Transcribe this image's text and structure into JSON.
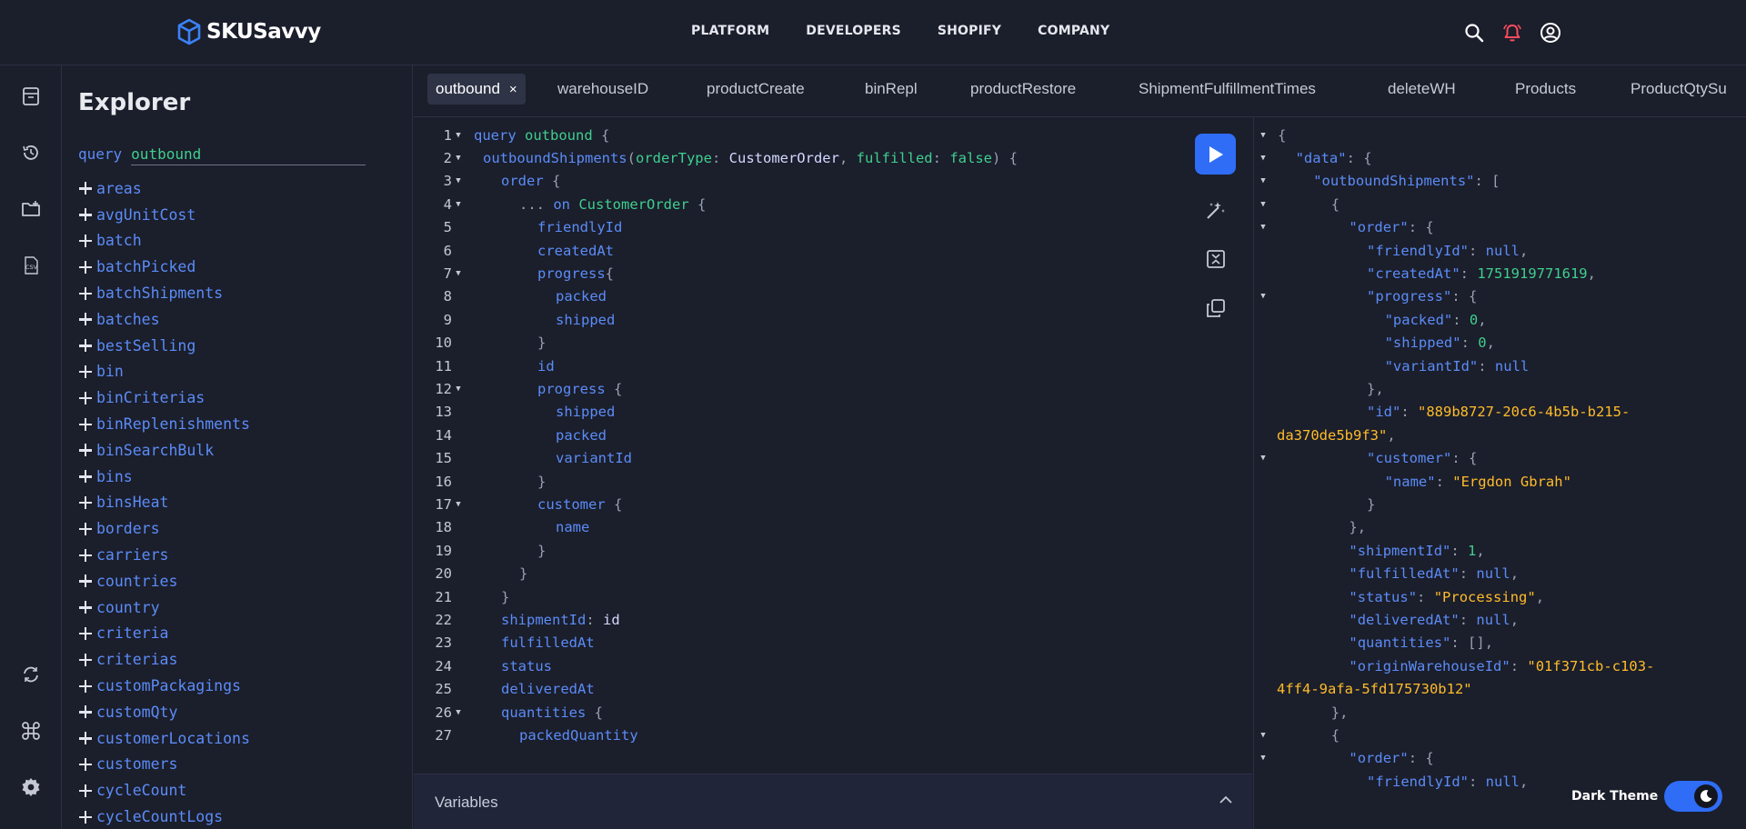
{
  "brand": {
    "name": "SKUSavvy"
  },
  "nav": {
    "links": [
      "PLATFORM",
      "DEVELOPERS",
      "SHOPIFY",
      "COMPANY"
    ]
  },
  "explorer": {
    "title": "Explorer",
    "query_keyword": "query",
    "query_name": "outbound",
    "fields": [
      "areas",
      "avgUnitCost",
      "batch",
      "batchPicked",
      "batchShipments",
      "batches",
      "bestSelling",
      "bin",
      "binCriterias",
      "binReplenishments",
      "binSearchBulk",
      "bins",
      "binsHeat",
      "borders",
      "carriers",
      "countries",
      "country",
      "criteria",
      "criterias",
      "customPackagings",
      "customQty",
      "customerLocations",
      "customers",
      "cycleCount",
      "cycleCountLogs"
    ]
  },
  "tabs": [
    {
      "label": "outbound",
      "active": true
    },
    {
      "label": "warehouseID"
    },
    {
      "label": "productCreate"
    },
    {
      "label": "binRepl"
    },
    {
      "label": "productRestore"
    },
    {
      "label": "ShipmentFulfillmentTimes"
    },
    {
      "label": "deleteWH"
    },
    {
      "label": "Products"
    },
    {
      "label": "ProductQtySu"
    }
  ],
  "tab_close": "×",
  "editor": {
    "lines": [
      {
        "n": "1",
        "fold": true,
        "indent": 0,
        "tokens": [
          [
            "k",
            "query"
          ],
          [
            "w",
            " "
          ],
          [
            "n",
            "outbound"
          ],
          [
            "p",
            " {"
          ]
        ]
      },
      {
        "n": "2",
        "fold": true,
        "indent": 1,
        "tokens": [
          [
            "f",
            "outboundShipments"
          ],
          [
            "p",
            "("
          ],
          [
            "a",
            "orderType"
          ],
          [
            "p",
            ": "
          ],
          [
            "ty",
            "CustomerOrder"
          ],
          [
            "p",
            ", "
          ],
          [
            "a",
            "fulfilled"
          ],
          [
            "p",
            ": "
          ],
          [
            "a",
            "false"
          ],
          [
            "p",
            ") {"
          ]
        ]
      },
      {
        "n": "3",
        "fold": true,
        "indent": 3,
        "tokens": [
          [
            "f",
            "order"
          ],
          [
            "p",
            " {"
          ]
        ]
      },
      {
        "n": "4",
        "fold": true,
        "indent": 5,
        "tokens": [
          [
            "p",
            "... "
          ],
          [
            "k",
            "on"
          ],
          [
            "w",
            " "
          ],
          [
            "n",
            "CustomerOrder"
          ],
          [
            "p",
            " {"
          ]
        ]
      },
      {
        "n": "5",
        "fold": false,
        "indent": 7,
        "tokens": [
          [
            "f",
            "friendlyId"
          ]
        ]
      },
      {
        "n": "6",
        "fold": false,
        "indent": 7,
        "tokens": [
          [
            "f",
            "createdAt"
          ]
        ]
      },
      {
        "n": "7",
        "fold": true,
        "indent": 7,
        "tokens": [
          [
            "f",
            "progress"
          ],
          [
            "p",
            "{"
          ]
        ]
      },
      {
        "n": "8",
        "fold": false,
        "indent": 9,
        "tokens": [
          [
            "f",
            "packed"
          ]
        ]
      },
      {
        "n": "9",
        "fold": false,
        "indent": 9,
        "tokens": [
          [
            "f",
            "shipped"
          ]
        ]
      },
      {
        "n": "10",
        "fold": false,
        "indent": 7,
        "tokens": [
          [
            "p",
            "}"
          ]
        ]
      },
      {
        "n": "11",
        "fold": false,
        "indent": 7,
        "tokens": [
          [
            "f",
            "id"
          ]
        ]
      },
      {
        "n": "12",
        "fold": true,
        "indent": 7,
        "tokens": [
          [
            "f",
            "progress"
          ],
          [
            "p",
            " {"
          ]
        ]
      },
      {
        "n": "13",
        "fold": false,
        "indent": 9,
        "tokens": [
          [
            "f",
            "shipped"
          ]
        ]
      },
      {
        "n": "14",
        "fold": false,
        "indent": 9,
        "tokens": [
          [
            "f",
            "packed"
          ]
        ]
      },
      {
        "n": "15",
        "fold": false,
        "indent": 9,
        "tokens": [
          [
            "f",
            "variantId"
          ]
        ]
      },
      {
        "n": "16",
        "fold": false,
        "indent": 7,
        "tokens": [
          [
            "p",
            "}"
          ]
        ]
      },
      {
        "n": "17",
        "fold": true,
        "indent": 7,
        "tokens": [
          [
            "f",
            "customer"
          ],
          [
            "p",
            " {"
          ]
        ]
      },
      {
        "n": "18",
        "fold": false,
        "indent": 9,
        "tokens": [
          [
            "f",
            "name"
          ]
        ]
      },
      {
        "n": "19",
        "fold": false,
        "indent": 7,
        "tokens": [
          [
            "p",
            "}"
          ]
        ]
      },
      {
        "n": "20",
        "fold": false,
        "indent": 5,
        "tokens": [
          [
            "p",
            "}"
          ]
        ]
      },
      {
        "n": "21",
        "fold": false,
        "indent": 3,
        "tokens": [
          [
            "p",
            "}"
          ]
        ]
      },
      {
        "n": "22",
        "fold": false,
        "indent": 3,
        "tokens": [
          [
            "f",
            "shipmentId"
          ],
          [
            "p",
            ": "
          ],
          [
            "ty",
            "id"
          ]
        ]
      },
      {
        "n": "23",
        "fold": false,
        "indent": 3,
        "tokens": [
          [
            "f",
            "fulfilledAt"
          ]
        ]
      },
      {
        "n": "24",
        "fold": false,
        "indent": 3,
        "tokens": [
          [
            "f",
            "status"
          ]
        ]
      },
      {
        "n": "25",
        "fold": false,
        "indent": 3,
        "tokens": [
          [
            "f",
            "deliveredAt"
          ]
        ]
      },
      {
        "n": "26",
        "fold": true,
        "indent": 3,
        "tokens": [
          [
            "f",
            "quantities"
          ],
          [
            "p",
            " {"
          ]
        ]
      },
      {
        "n": "27",
        "fold": false,
        "indent": 5,
        "tokens": [
          [
            "f",
            "packedQuantity"
          ]
        ]
      }
    ]
  },
  "variables": {
    "label": "Variables"
  },
  "result": {
    "lines": [
      {
        "fold": true,
        "indent": 0,
        "tokens": [
          [
            "rp",
            "{"
          ]
        ]
      },
      {
        "fold": true,
        "indent": 2,
        "tokens": [
          [
            "rk",
            "\"data\""
          ],
          [
            "rp",
            ": {"
          ]
        ]
      },
      {
        "fold": true,
        "indent": 4,
        "tokens": [
          [
            "rk",
            "\"outboundShipments\""
          ],
          [
            "rp",
            ": ["
          ]
        ]
      },
      {
        "fold": true,
        "indent": 6,
        "tokens": [
          [
            "rp",
            "{"
          ]
        ]
      },
      {
        "fold": true,
        "indent": 8,
        "tokens": [
          [
            "rk",
            "\"order\""
          ],
          [
            "rp",
            ": {"
          ]
        ]
      },
      {
        "fold": false,
        "indent": 10,
        "tokens": [
          [
            "rk",
            "\"friendlyId\""
          ],
          [
            "rp",
            ": "
          ],
          [
            "rnull",
            "null"
          ],
          [
            "rp",
            ","
          ]
        ]
      },
      {
        "fold": false,
        "indent": 10,
        "tokens": [
          [
            "rk",
            "\"createdAt\""
          ],
          [
            "rp",
            ": "
          ],
          [
            "rn",
            "1751919771619"
          ],
          [
            "rp",
            ","
          ]
        ]
      },
      {
        "fold": true,
        "indent": 10,
        "tokens": [
          [
            "rk",
            "\"progress\""
          ],
          [
            "rp",
            ": {"
          ]
        ]
      },
      {
        "fold": false,
        "indent": 12,
        "tokens": [
          [
            "rk",
            "\"packed\""
          ],
          [
            "rp",
            ": "
          ],
          [
            "rn",
            "0"
          ],
          [
            "rp",
            ","
          ]
        ]
      },
      {
        "fold": false,
        "indent": 12,
        "tokens": [
          [
            "rk",
            "\"shipped\""
          ],
          [
            "rp",
            ": "
          ],
          [
            "rn",
            "0"
          ],
          [
            "rp",
            ","
          ]
        ]
      },
      {
        "fold": false,
        "indent": 12,
        "tokens": [
          [
            "rk",
            "\"variantId\""
          ],
          [
            "rp",
            ": "
          ],
          [
            "rnull",
            "null"
          ]
        ]
      },
      {
        "fold": false,
        "indent": 10,
        "tokens": [
          [
            "rp",
            "},"
          ]
        ]
      },
      {
        "fold": false,
        "indent": 10,
        "tokens": [
          [
            "rk",
            "\"id\""
          ],
          [
            "rp",
            ": "
          ],
          [
            "rs",
            "\"889b8727-20c6-4b5b-b215-"
          ]
        ]
      },
      {
        "fold": false,
        "indent": 0,
        "tokens": [
          [
            "rs",
            "da370de5b9f3\""
          ],
          [
            "rp",
            ","
          ]
        ]
      },
      {
        "fold": true,
        "indent": 10,
        "tokens": [
          [
            "rk",
            "\"customer\""
          ],
          [
            "rp",
            ": {"
          ]
        ]
      },
      {
        "fold": false,
        "indent": 12,
        "tokens": [
          [
            "rk",
            "\"name\""
          ],
          [
            "rp",
            ": "
          ],
          [
            "rs",
            "\"Ergdon Gbrah\""
          ]
        ]
      },
      {
        "fold": false,
        "indent": 10,
        "tokens": [
          [
            "rp",
            "}"
          ]
        ]
      },
      {
        "fold": false,
        "indent": 8,
        "tokens": [
          [
            "rp",
            "},"
          ]
        ]
      },
      {
        "fold": false,
        "indent": 8,
        "tokens": [
          [
            "rk",
            "\"shipmentId\""
          ],
          [
            "rp",
            ": "
          ],
          [
            "rn",
            "1"
          ],
          [
            "rp",
            ","
          ]
        ]
      },
      {
        "fold": false,
        "indent": 8,
        "tokens": [
          [
            "rk",
            "\"fulfilledAt\""
          ],
          [
            "rp",
            ": "
          ],
          [
            "rnull",
            "null"
          ],
          [
            "rp",
            ","
          ]
        ]
      },
      {
        "fold": false,
        "indent": 8,
        "tokens": [
          [
            "rk",
            "\"status\""
          ],
          [
            "rp",
            ": "
          ],
          [
            "rs",
            "\"Processing\""
          ],
          [
            "rp",
            ","
          ]
        ]
      },
      {
        "fold": false,
        "indent": 8,
        "tokens": [
          [
            "rk",
            "\"deliveredAt\""
          ],
          [
            "rp",
            ": "
          ],
          [
            "rnull",
            "null"
          ],
          [
            "rp",
            ","
          ]
        ]
      },
      {
        "fold": false,
        "indent": 8,
        "tokens": [
          [
            "rk",
            "\"quantities\""
          ],
          [
            "rp",
            ": [],"
          ]
        ]
      },
      {
        "fold": false,
        "indent": 8,
        "tokens": [
          [
            "rk",
            "\"originWarehouseId\""
          ],
          [
            "rp",
            ": "
          ],
          [
            "rs",
            "\"01f371cb-c103-"
          ]
        ]
      },
      {
        "fold": false,
        "indent": 0,
        "tokens": [
          [
            "rs",
            "4ff4-9afa-5fd175730b12\""
          ]
        ]
      },
      {
        "fold": false,
        "indent": 6,
        "tokens": [
          [
            "rp",
            "},"
          ]
        ]
      },
      {
        "fold": true,
        "indent": 6,
        "tokens": [
          [
            "rp",
            "{"
          ]
        ]
      },
      {
        "fold": true,
        "indent": 8,
        "tokens": [
          [
            "rk",
            "\"order\""
          ],
          [
            "rp",
            ": {"
          ]
        ]
      },
      {
        "fold": false,
        "indent": 10,
        "tokens": [
          [
            "rk",
            "\"friendlyId\""
          ],
          [
            "rp",
            ": "
          ],
          [
            "rnull",
            "null"
          ],
          [
            "rp",
            ","
          ]
        ]
      }
    ]
  },
  "theme": {
    "label": "Dark Theme"
  },
  "colors": {
    "accent": "#2f6df6",
    "background": "#1b1e2b",
    "field": "#5b8cf7",
    "name": "#3fcf8e",
    "string": "#ffbc2a",
    "bell": "#ff4d5e"
  }
}
